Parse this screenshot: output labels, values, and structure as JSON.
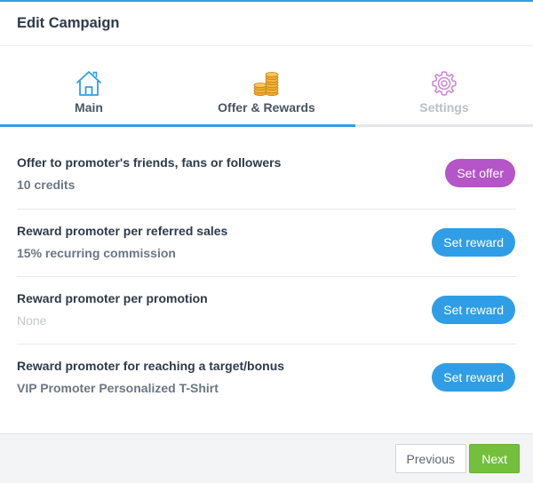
{
  "dialog": {
    "title": "Edit Campaign"
  },
  "tabs": [
    {
      "label": "Main",
      "icon": "house-icon",
      "state": "completed"
    },
    {
      "label": "Offer & Rewards",
      "icon": "coins-icon",
      "state": "active"
    },
    {
      "label": "Settings",
      "icon": "gear-icon",
      "state": "disabled"
    }
  ],
  "rows": [
    {
      "title": "Offer to promoter's friends, fans or followers",
      "value": "10 credits",
      "button": "Set offer"
    },
    {
      "title": "Reward promoter per referred sales",
      "value": "15% recurring commission",
      "button": "Set reward"
    },
    {
      "title": "Reward promoter per promotion",
      "value": "None",
      "button": "Set reward"
    },
    {
      "title": "Reward promoter for reaching a target/bonus",
      "value": "VIP Promoter Personalized T-Shirt",
      "button": "Set reward"
    }
  ],
  "footer": {
    "previous_label": "Previous",
    "next_label": "Next"
  },
  "colors": {
    "accent": "#2f9ee6",
    "offer_button": "#b455c8",
    "next_button": "#74bf3c",
    "coins": "#f0a928",
    "settings_icon": "#c98ad6"
  }
}
